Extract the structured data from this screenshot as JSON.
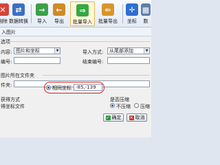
{
  "toolbar": {
    "items": [
      {
        "label": "删除",
        "icon": "delete-icon"
      },
      {
        "label": "数据转换",
        "icon": "data-convert-icon"
      },
      {
        "label": "导入",
        "icon": "import-icon"
      },
      {
        "label": "导出",
        "icon": "export-icon"
      },
      {
        "label": "批量导入",
        "icon": "batch-import-icon"
      },
      {
        "label": "批量导出",
        "icon": "batch-export-icon"
      },
      {
        "label": "坐标",
        "icon": "coordinate-icon"
      },
      {
        "label": "数",
        "icon": "grid-icon"
      }
    ],
    "active_index": 4
  },
  "dialog": {
    "title": "入图片",
    "options_heading": "选项",
    "content_label": "内容:",
    "content_value": "图片和坐标",
    "import_mode_label": "导入方式:",
    "import_mode_value": "从尾部添加",
    "start_number_label": "编号:",
    "end_number_label": "结束编号:",
    "folder_heading": "图片所在文件夹",
    "folder_label": "件夹:",
    "acquire_heading": "获得方式",
    "acquire_label": "得坐标文件",
    "relative_coord_label": "相同坐标",
    "relative_coord_value": "-85,-139",
    "compress_heading": "是否压缩",
    "no_compress_label": "不压缩",
    "compress_label": "压缩",
    "ok_label": "确定",
    "cancel_label": "取消"
  },
  "colors": {
    "accent_blue": "#2a64b8",
    "highlight_red": "#e02020",
    "ok_green": "#2e9a3c",
    "cancel_red": "#c8382c"
  }
}
